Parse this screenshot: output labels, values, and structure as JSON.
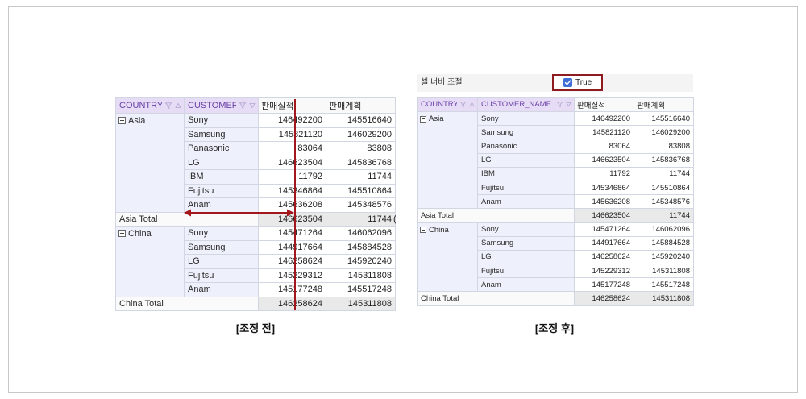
{
  "captions": {
    "before": "[조정 전]",
    "after": "[조정 후]"
  },
  "toolbar": {
    "label": "셀 너비 조절",
    "checkbox_label": "True",
    "checked": true
  },
  "before_grid": {
    "headers": {
      "country": "COUNTRY_",
      "customer": "CUSTOMER_",
      "actual": "판매실적",
      "plan": "판매계획"
    },
    "groups": [
      {
        "country": "Asia",
        "rows": [
          {
            "customer": "Sony",
            "actual": "146492200",
            "plan": "145516640"
          },
          {
            "customer": "Samsung",
            "actual": "145821120",
            "plan": "146029200"
          },
          {
            "customer": "Panasonic",
            "actual": "83064",
            "plan": "83808"
          },
          {
            "customer": "LG",
            "actual": "146623504",
            "plan": "145836768"
          },
          {
            "customer": "IBM",
            "actual": "11792",
            "plan": "11744"
          },
          {
            "customer": "Fujitsu",
            "actual": "145346864",
            "plan": "145510864"
          },
          {
            "customer": "Anam",
            "actual": "145636208",
            "plan": "145348576"
          }
        ],
        "total": {
          "label": "Asia Total",
          "actual": "146623504",
          "plan": "11744"
        }
      },
      {
        "country": "China",
        "rows": [
          {
            "customer": "Sony",
            "actual": "145471264",
            "plan": "146062096"
          },
          {
            "customer": "Samsung",
            "actual": "144917664",
            "plan": "145884528"
          },
          {
            "customer": "LG",
            "actual": "146258624",
            "plan": "145920240"
          },
          {
            "customer": "Fujitsu",
            "actual": "145229312",
            "plan": "145311808"
          },
          {
            "customer": "Anam",
            "actual": "145177248",
            "plan": "145517248"
          }
        ],
        "total": {
          "label": "China Total",
          "actual": "146258624",
          "plan": "145311808"
        }
      }
    ],
    "overflow_fragment": "("
  },
  "after_grid": {
    "headers": {
      "country": "COUNTRY_",
      "customer": "CUSTOMER_NAME",
      "actual": "판매실적",
      "plan": "판매계획"
    },
    "groups": [
      {
        "country": "Asia",
        "rows": [
          {
            "customer": "Sony",
            "actual": "146492200",
            "plan": "145516640"
          },
          {
            "customer": "Samsung",
            "actual": "145821120",
            "plan": "146029200"
          },
          {
            "customer": "Panasonic",
            "actual": "83064",
            "plan": "83808"
          },
          {
            "customer": "LG",
            "actual": "146623504",
            "plan": "145836768"
          },
          {
            "customer": "IBM",
            "actual": "11792",
            "plan": "11744"
          },
          {
            "customer": "Fujitsu",
            "actual": "145346864",
            "plan": "145510864"
          },
          {
            "customer": "Anam",
            "actual": "145636208",
            "plan": "145348576"
          }
        ],
        "total": {
          "label": "Asia Total",
          "actual": "146623504",
          "plan": "11744"
        }
      },
      {
        "country": "China",
        "rows": [
          {
            "customer": "Sony",
            "actual": "145471264",
            "plan": "146062096"
          },
          {
            "customer": "Samsung",
            "actual": "144917664",
            "plan": "145884528"
          },
          {
            "customer": "LG",
            "actual": "146258624",
            "plan": "145920240"
          },
          {
            "customer": "Fujitsu",
            "actual": "145229312",
            "plan": "145311808"
          },
          {
            "customer": "Anam",
            "actual": "145177248",
            "plan": "145517248"
          }
        ],
        "total": {
          "label": "China Total",
          "actual": "146258624",
          "plan": "145311808"
        }
      }
    ]
  },
  "icons": {
    "filter": "filter-icon",
    "sort_asc": "sort-ascending-icon",
    "sort_desc": "sort-descending-icon",
    "collapse": "collapse-icon",
    "check": "check-icon"
  },
  "colors": {
    "annotation_red": "#a3161c",
    "checkbox_blue": "#3f6fd6",
    "header_text_purple": "#6b42a8",
    "header_bg": "#e6dcf6",
    "dimension_bg": "#eef0fb",
    "total_value_bg": "#e9e9e9"
  }
}
